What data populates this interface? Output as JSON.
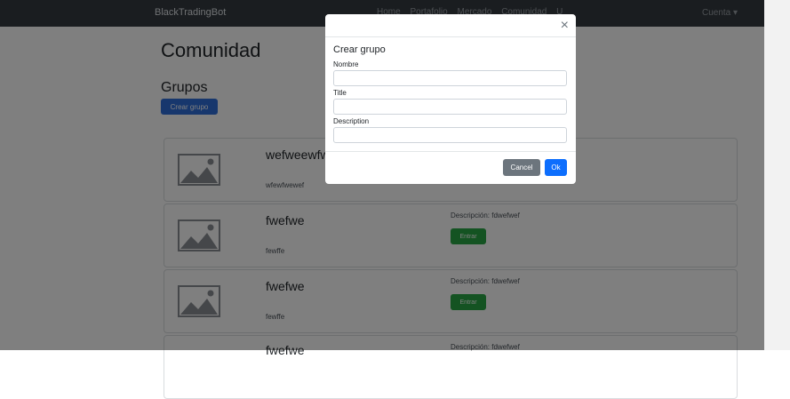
{
  "navbar": {
    "brand": "BlackTradingBot",
    "links": [
      "Home",
      "Portafolio",
      "Mercado",
      "Comunidad",
      "U"
    ],
    "account": "Cuenta ▾"
  },
  "main": {
    "title": "Comunidad",
    "section_title": "Grupos",
    "create_button": "Crear grupo"
  },
  "groups": [
    {
      "name": "wefweewfwe",
      "subtitle": "wfewfwewef",
      "description": "",
      "enter_label": ""
    },
    {
      "name": "fwefwe",
      "subtitle": "fewffe",
      "description": "Descripción: fdwefwef",
      "enter_label": "Entrar"
    },
    {
      "name": "fwefwe",
      "subtitle": "fewffe",
      "description": "Descripción: fdwefwef",
      "enter_label": "Entrar"
    },
    {
      "name": "fwefwe",
      "subtitle": "",
      "description": "Descripción: fdwefwef",
      "enter_label": ""
    }
  ],
  "modal": {
    "close_glyph": "×",
    "title": "Crear grupo",
    "fields": [
      {
        "label": "Nombre",
        "value": ""
      },
      {
        "label": "Title",
        "value": ""
      },
      {
        "label": "Description",
        "value": ""
      }
    ],
    "cancel_label": "Cancel",
    "ok_label": "Ok"
  }
}
